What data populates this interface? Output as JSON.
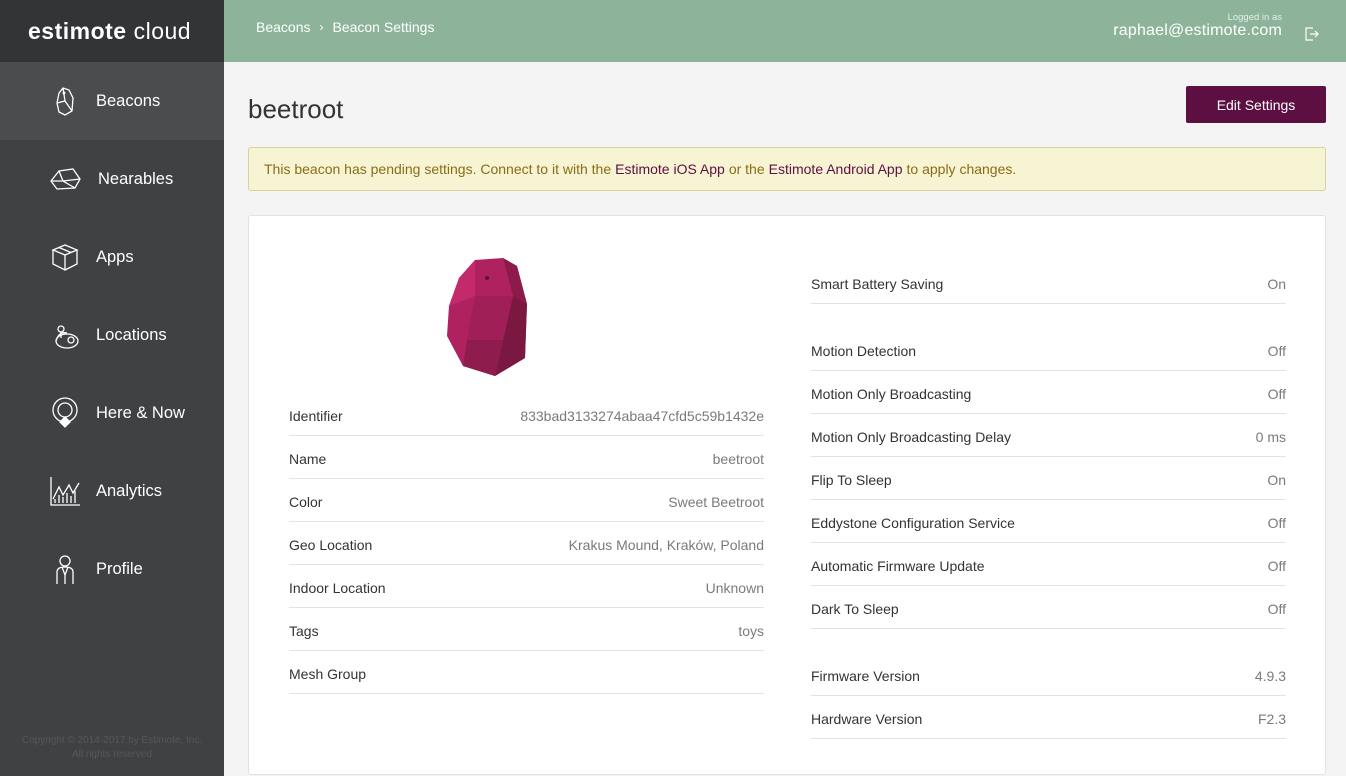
{
  "app": {
    "logo_bold": "estimote",
    "logo_light": "cloud"
  },
  "sidebar": {
    "items": [
      {
        "label": "Beacons",
        "icon": "beacon-icon",
        "active": true
      },
      {
        "label": "Nearables",
        "icon": "nearable-icon",
        "active": false
      },
      {
        "label": "Apps",
        "icon": "apps-box-icon",
        "active": false
      },
      {
        "label": "Locations",
        "icon": "locations-icon",
        "active": false
      },
      {
        "label": "Here & Now",
        "icon": "here-now-pin-icon",
        "active": false
      },
      {
        "label": "Analytics",
        "icon": "analytics-chart-icon",
        "active": false
      },
      {
        "label": "Profile",
        "icon": "profile-person-icon",
        "active": false
      }
    ],
    "copyright_line1": "Copyright © 2014-2017 by Estimote, Inc.",
    "copyright_line2": "All rights reserved"
  },
  "header": {
    "breadcrumb": [
      "Beacons",
      "Beacon Settings"
    ],
    "breadcrumb_sep": "›",
    "login_caption": "Logged in as",
    "email": "raphael@estimote.com",
    "logout_icon": "logout-icon"
  },
  "page": {
    "title": "beetroot",
    "edit_button": "Edit Settings",
    "alert": {
      "text_before": "This beacon has pending settings. Connect to it with the",
      "ios_link": "Estimote iOS App",
      "text_middle": "or the",
      "android_link": "Estimote Android App",
      "text_after": "to apply changes."
    }
  },
  "beacon": {
    "image_icon": "beacon-device-illustration",
    "color_hex": "#b0225f",
    "details": [
      {
        "label": "Identifier",
        "value": "833bad3133274abaa47cfd5c59b1432e"
      },
      {
        "label": "Name",
        "value": "beetroot"
      },
      {
        "label": "Color",
        "value": "Sweet Beetroot"
      },
      {
        "label": "Geo Location",
        "value": "Krakus Mound, Kraków, Poland"
      },
      {
        "label": "Indoor Location",
        "value": "Unknown"
      },
      {
        "label": "Tags",
        "value": "toys"
      },
      {
        "label": "Mesh Group",
        "value": ""
      }
    ],
    "settings_group1": [
      {
        "label": "Smart Battery Saving",
        "value": "On"
      }
    ],
    "settings_group2": [
      {
        "label": "Motion Detection",
        "value": "Off"
      },
      {
        "label": "Motion Only Broadcasting",
        "value": "Off"
      },
      {
        "label": "Motion Only Broadcasting Delay",
        "value": "0 ms"
      },
      {
        "label": "Flip To Sleep",
        "value": "On"
      },
      {
        "label": "Eddystone Configuration Service",
        "value": "Off"
      },
      {
        "label": "Automatic Firmware Update",
        "value": "Off"
      },
      {
        "label": "Dark To Sleep",
        "value": "Off"
      }
    ],
    "settings_group3": [
      {
        "label": "Firmware Version",
        "value": "4.9.3"
      },
      {
        "label": "Hardware Version",
        "value": "F2.3"
      }
    ]
  },
  "colors": {
    "sidebar_bg": "#3f4143",
    "header_bg": "#8db49a",
    "accent": "#5d0f41",
    "alert_bg": "#f7f4d3"
  }
}
